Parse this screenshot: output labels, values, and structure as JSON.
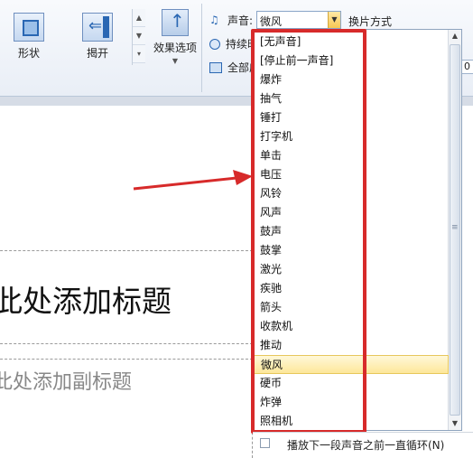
{
  "ribbon": {
    "effects": [
      {
        "label": "形状",
        "icon": "shape-effect-icon"
      },
      {
        "label": "揭开",
        "icon": "uncover-effect-icon"
      }
    ],
    "effect_options_label": "效果选项",
    "sound_label": "声音:",
    "sound_value": "微风",
    "switch_label": "换片方式",
    "duration_label": "持续时",
    "apply_label": "全部应",
    "right_box_text": "0"
  },
  "slide": {
    "title_placeholder": "此处添加标题",
    "subtitle_placeholder": "此处添加副标题"
  },
  "sound_list": {
    "items": [
      "[无声音]",
      "[停止前一声音]",
      "爆炸",
      "抽气",
      "锤打",
      "打字机",
      "单击",
      "电压",
      "风铃",
      "风声",
      "鼓声",
      "鼓掌",
      "激光",
      "疾驰",
      "箭头",
      "收款机",
      "推动",
      "微风",
      "硬币",
      "炸弹",
      "照相机"
    ],
    "selected": "微风"
  },
  "loop_label": "播放下一段声音之前一直循环(N)",
  "colors": {
    "highlight": "#d72a2a",
    "selected_bg": "#fde79a"
  }
}
